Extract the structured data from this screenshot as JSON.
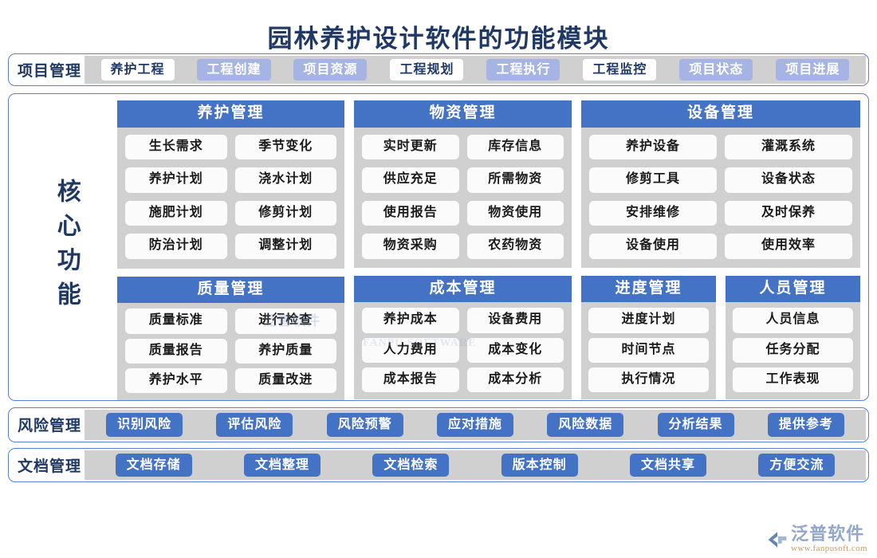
{
  "title": "园林养护设计软件的功能模块",
  "colors": {
    "title_navy": "#1f3864",
    "header_blue": "#4472c4",
    "pale_blue": "#a6b4e3",
    "panel_gray": "#d0d0d0",
    "cell_white": "#fbfbfb",
    "frame_border": "#5b7fd4"
  },
  "project_row": {
    "label": "项目管理",
    "chips": [
      {
        "text": "养护工程",
        "style": "light"
      },
      {
        "text": "工程创建",
        "style": "pale"
      },
      {
        "text": "项目资源",
        "style": "pale"
      },
      {
        "text": "工程规划",
        "style": "light"
      },
      {
        "text": "工程执行",
        "style": "pale"
      },
      {
        "text": "工程监控",
        "style": "light"
      },
      {
        "text": "项目状态",
        "style": "pale"
      },
      {
        "text": "项目进展",
        "style": "pale"
      }
    ]
  },
  "core": {
    "label": "核心功能",
    "modules": [
      {
        "key": "maintenance",
        "title": "养护管理",
        "columns": 2,
        "items": [
          "生长需求",
          "季节变化",
          "养护计划",
          "浇水计划",
          "施肥计划",
          "修剪计划",
          "防治计划",
          "调整计划"
        ]
      },
      {
        "key": "quality",
        "title": "质量管理",
        "columns": 2,
        "items": [
          "质量标准",
          "进行检查",
          "质量报告",
          "养护质量",
          "养护水平",
          "质量改进"
        ]
      },
      {
        "key": "material",
        "title": "物资管理",
        "columns": 2,
        "items": [
          "实时更新",
          "库存信息",
          "供应充足",
          "所需物资",
          "使用报告",
          "物资使用",
          "物资采购",
          "农药物资"
        ]
      },
      {
        "key": "cost",
        "title": "成本管理",
        "columns": 2,
        "items": [
          "养护成本",
          "设备费用",
          "人力费用",
          "成本变化",
          "成本报告",
          "成本分析"
        ]
      },
      {
        "key": "equipment",
        "title": "设备管理",
        "columns": 2,
        "items": [
          "养护设备",
          "灌溉系统",
          "修剪工具",
          "设备状态",
          "安排维修",
          "及时保养",
          "设备使用",
          "使用效率"
        ]
      },
      {
        "key": "progress",
        "title": "进度管理",
        "columns": 1,
        "items": [
          "进度计划",
          "时间节点",
          "执行情况"
        ]
      },
      {
        "key": "people",
        "title": "人员管理",
        "columns": 1,
        "items": [
          "人员信息",
          "任务分配",
          "工作表现"
        ]
      }
    ]
  },
  "risk_row": {
    "label": "风险管理",
    "chips": [
      {
        "text": "识别风险",
        "style": "solid"
      },
      {
        "text": "评估风险",
        "style": "solid"
      },
      {
        "text": "风险预警",
        "style": "solid"
      },
      {
        "text": "应对措施",
        "style": "solid"
      },
      {
        "text": "风险数据",
        "style": "solid"
      },
      {
        "text": "分析结果",
        "style": "solid"
      },
      {
        "text": "提供参考",
        "style": "solid"
      }
    ]
  },
  "document_row": {
    "label": "文档管理",
    "chips": [
      {
        "text": "文档存储",
        "style": "solid"
      },
      {
        "text": "文档整理",
        "style": "solid"
      },
      {
        "text": "文档检索",
        "style": "solid"
      },
      {
        "text": "版本控制",
        "style": "solid"
      },
      {
        "text": "文档共享",
        "style": "solid"
      },
      {
        "text": "方便交流",
        "style": "solid"
      }
    ]
  },
  "watermark": {
    "main": "泛普软件",
    "sub": "FANPU SOFTWARE"
  },
  "logo": {
    "name": "泛普软件",
    "url": "www.fanpusoft.com"
  }
}
